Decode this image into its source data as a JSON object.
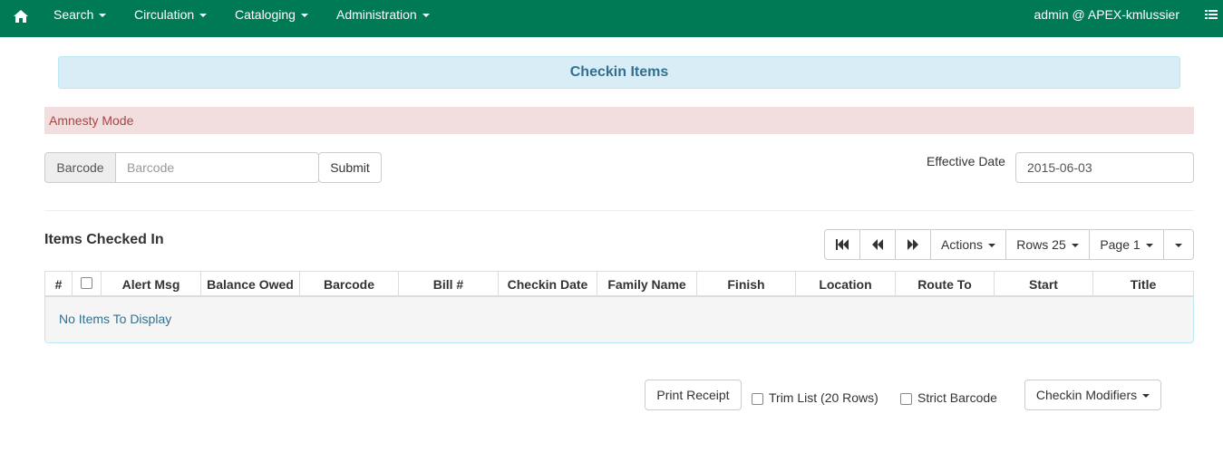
{
  "navbar": {
    "home_icon": "home-icon",
    "menus": [
      {
        "label": "Search"
      },
      {
        "label": "Circulation"
      },
      {
        "label": "Cataloging"
      },
      {
        "label": "Administration"
      }
    ],
    "user": "admin @ APEX-kmlussier",
    "menu_icon": "list-icon",
    "bg_color": "#007a54"
  },
  "page": {
    "title": "Checkin Items",
    "amnesty_mode": "Amnesty Mode"
  },
  "checkin_form": {
    "barcode_label": "Barcode",
    "barcode_placeholder": "Barcode",
    "barcode_value": "",
    "submit_label": "Submit",
    "effective_date_label": "Effective Date",
    "effective_date_value": "2015-06-03"
  },
  "grid": {
    "title": "Items Checked In",
    "toolbar": {
      "first_page_icon": "first-page-icon",
      "prev_page_icon": "prev-page-icon",
      "next_page_icon": "next-page-icon",
      "actions_label": "Actions",
      "rows_label": "Rows 25",
      "page_label": "Page 1"
    },
    "columns": [
      "#",
      "",
      "Alert Msg",
      "Balance Owed",
      "Barcode",
      "Bill #",
      "Checkin Date",
      "Family Name",
      "Finish",
      "Location",
      "Route To",
      "Start",
      "Title"
    ],
    "rows": [],
    "empty_message": "No Items To Display"
  },
  "footer": {
    "print_receipt_label": "Print Receipt",
    "trim_list_label": "Trim List (20 Rows)",
    "trim_list_checked": false,
    "strict_barcode_label": "Strict Barcode",
    "strict_barcode_checked": false,
    "checkin_modifiers_label": "Checkin Modifiers"
  }
}
